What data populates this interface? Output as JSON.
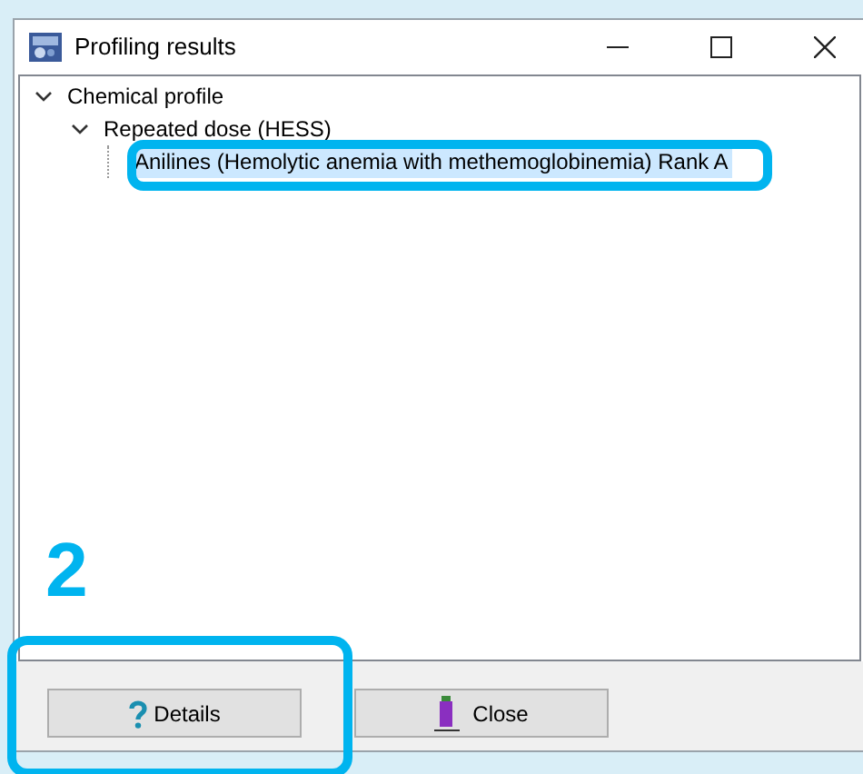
{
  "window": {
    "title": "Profiling results"
  },
  "tree": [
    {
      "label": "Chemical profile",
      "expanded": true,
      "selected": false,
      "children": [
        {
          "label": "Repeated dose (HESS)",
          "expanded": true,
          "selected": false,
          "children": [
            {
              "label": "Anilines (Hemolytic anemia with methemoglobinemia) Rank A",
              "selected": true
            }
          ]
        }
      ]
    }
  ],
  "buttons": [
    {
      "kind": "details",
      "label": "Details"
    },
    {
      "kind": "close",
      "label": "Close"
    }
  ],
  "annotation": {
    "label": "2"
  }
}
